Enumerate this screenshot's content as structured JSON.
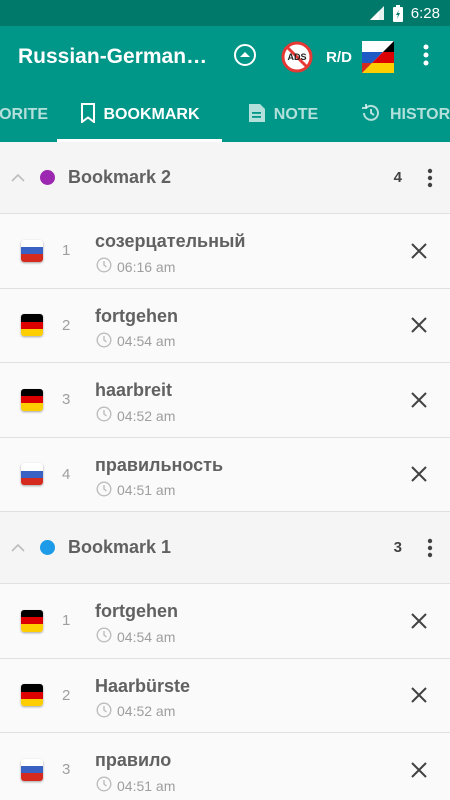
{
  "status_bar": {
    "time": "6:28"
  },
  "app_bar": {
    "title": "Russian-German Dictionary",
    "ads_label": "ADS",
    "rd_label": "R/D"
  },
  "tabs": [
    {
      "label": "FAVORITE",
      "icon": "star-icon"
    },
    {
      "label": "BOOKMARK",
      "icon": "bookmark-icon",
      "active": true
    },
    {
      "label": "NOTE",
      "icon": "note-icon"
    },
    {
      "label": "HISTORY",
      "icon": "history-icon"
    }
  ],
  "colors": {
    "primary": "#009688",
    "primary_dark": "#00796b",
    "bookmark2_dot": "#9c27b0",
    "bookmark1_dot": "#1e9be8"
  },
  "groups": [
    {
      "title": "Bookmark 2",
      "count": "4",
      "dot_color": "#9c27b0",
      "items": [
        {
          "num": "1",
          "word": "созерцательный",
          "time": "06:16 am",
          "flag": "ru"
        },
        {
          "num": "2",
          "word": "fortgehen",
          "time": "04:54 am",
          "flag": "de"
        },
        {
          "num": "3",
          "word": "haarbreit",
          "time": "04:52 am",
          "flag": "de"
        },
        {
          "num": "4",
          "word": "правильность",
          "time": "04:51 am",
          "flag": "ru"
        }
      ]
    },
    {
      "title": "Bookmark 1",
      "count": "3",
      "dot_color": "#1e9be8",
      "items": [
        {
          "num": "1",
          "word": "fortgehen",
          "time": "04:54 am",
          "flag": "de"
        },
        {
          "num": "2",
          "word": "Haarbürste",
          "time": "04:52 am",
          "flag": "de"
        },
        {
          "num": "3",
          "word": "правило",
          "time": "04:51 am",
          "flag": "ru"
        }
      ]
    }
  ]
}
